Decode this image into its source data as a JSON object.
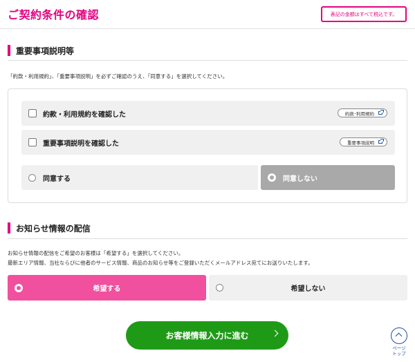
{
  "header": {
    "title": "ご契約条件の確認",
    "tax_note": "表記の金額はすべて税込です。"
  },
  "important": {
    "heading": "重要事項説明等",
    "description": "「約款・利用規約」、「重要事項説明」を必ずご確認のうえ、「同意する」を選択してください。",
    "items": [
      {
        "label": "約款・利用規約を確認した",
        "link": "約款･利用規約",
        "checked": false
      },
      {
        "label": "重要事項説明を確認した",
        "link": "重要事項説明",
        "checked": false
      }
    ],
    "agree_label": "同意する",
    "disagree_label": "同意しない",
    "selected": "同意しない"
  },
  "notice": {
    "heading": "お知らせ情報の配信",
    "description_line1": "お知らせ情報の配信をご希望のお客様は「希望する」を選択してください。",
    "description_line2": "最新エリア情報、当社ならびに他者のサービス情報、商品のお知らせ等をご登録いただくメールアドレス宛てにお送りいたします。",
    "want_label": "希望する",
    "not_want_label": "希望しない",
    "selected": "希望する"
  },
  "proceed_label": "お客様情報入力に進む",
  "page_top": {
    "line1": "ページ",
    "line2": "トップ"
  },
  "colors": {
    "brand": "#e4007f",
    "selected_pink": "#f0509e",
    "proceed_green": "#1f9a17",
    "disabled_gray": "#a9a9a9",
    "link_blue": "#1e4fa3"
  },
  "icons": [
    "external-link-icon",
    "chevron-right-icon",
    "arrow-up-icon"
  ]
}
